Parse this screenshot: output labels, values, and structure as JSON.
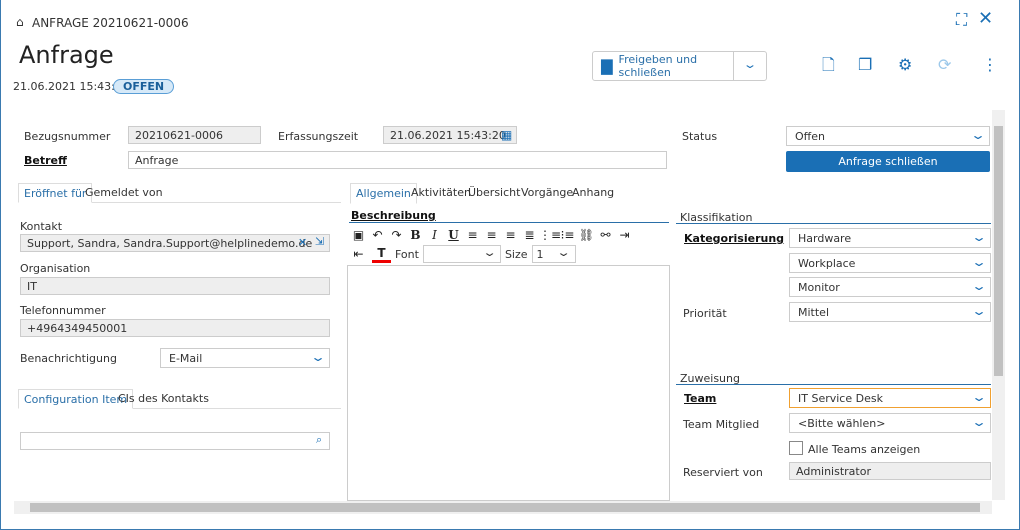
{
  "header": {
    "breadcrumb": "ANFRAGE 20210621-0006",
    "title": "Anfrage",
    "date": "21.06.2021 15:43:20",
    "status_badge": "OFFEN",
    "save_button": "Freigeben und schließen"
  },
  "form": {
    "bezugsnummer_label": "Bezugsnummer",
    "bezugsnummer": "20210621-0006",
    "erfassungszeit_label": "Erfassungszeit",
    "erfassungszeit": "21.06.2021 15:43:20",
    "betreff_label": "Betreff",
    "betreff": "Anfrage",
    "status_label": "Status",
    "status": "Offen",
    "close_button": "Anfrage schließen"
  },
  "left": {
    "tabs": [
      "Eröffnet für",
      "Gemeldet von"
    ],
    "kontakt_label": "Kontakt",
    "kontakt": "Support, Sandra, Sandra.Support@helplinedemo.de",
    "organisation_label": "Organisation",
    "organisation": "IT",
    "telefon_label": "Telefonnummer",
    "telefon": "+4964349450001",
    "benachrichtigung_label": "Benachrichtigung",
    "benachrichtigung": "E-Mail",
    "ci_tabs": [
      "Configuration Item",
      "CIs des Kontakts"
    ],
    "ci_search": ""
  },
  "middle": {
    "tabs": [
      "Allgemein",
      "Aktivitäten",
      "Übersicht",
      "Vorgänge",
      "Anhang"
    ],
    "beschreibung_label": "Beschreibung",
    "font_label": "Font",
    "font_value": "",
    "size_label": "Size",
    "size_value": "1",
    "text": ""
  },
  "right": {
    "klassifikation": "Klassifikation",
    "kategorisierung_label": "Kategorisierung",
    "kategorien": [
      "Hardware",
      "Workplace",
      "Monitor"
    ],
    "prioritaet_label": "Priorität",
    "prioritaet": "Mittel",
    "zuweisung": "Zuweisung",
    "team_label": "Team",
    "team": "IT Service Desk",
    "team_mitglied_label": "Team Mitglied",
    "team_mitglied": "<Bitte wählen>",
    "alle_teams": "Alle Teams anzeigen",
    "alle_teams_checked": false,
    "reserviert_label": "Reserviert von",
    "reserviert": "Administrator"
  },
  "colors": {
    "accent": "#1a6fb5",
    "badge_bg": "#d6e9f8",
    "close_button_bg": "#1a6fb5"
  }
}
